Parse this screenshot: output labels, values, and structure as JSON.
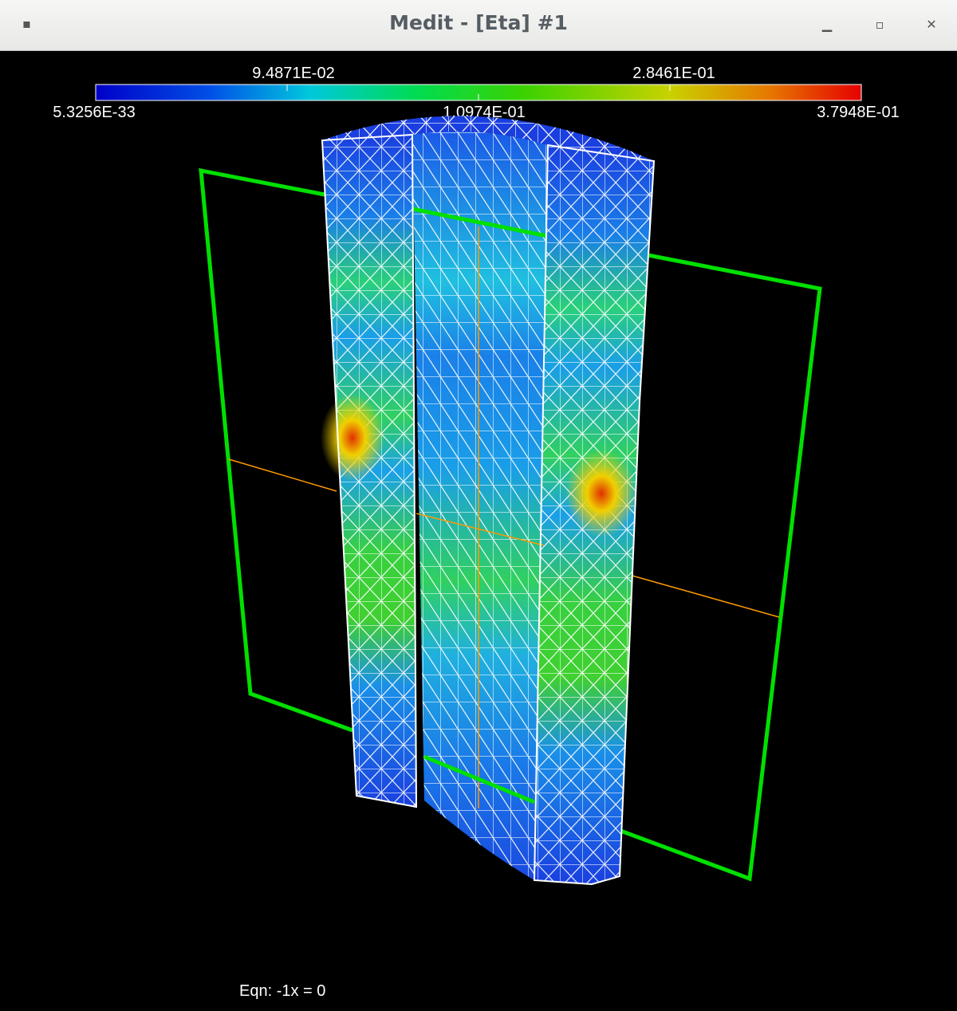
{
  "window": {
    "title": "Medit - [Eta] #1",
    "buttons": {
      "minimize_icon": "minimize-icon",
      "maximize_icon": "maximize-icon",
      "close_icon": "close-icon"
    }
  },
  "colorbar": {
    "upper_labels": [
      "9.4871E-02",
      "2.8461E-01"
    ],
    "lower_labels": [
      "5.3256E-33",
      "1.0974E-01",
      "3.7948E-01"
    ],
    "min": "5.3256E-33",
    "max": "3.7948E-01",
    "colors": [
      "#0000c8",
      "#0050e6",
      "#00c8dc",
      "#00dc50",
      "#3cd200",
      "#c8d200",
      "#e67800",
      "#e60000"
    ]
  },
  "clip_plane": {
    "color": "#00e000",
    "axis_color": "#ff9900"
  },
  "status": {
    "equation": "Eqn:  -1x = 0"
  }
}
